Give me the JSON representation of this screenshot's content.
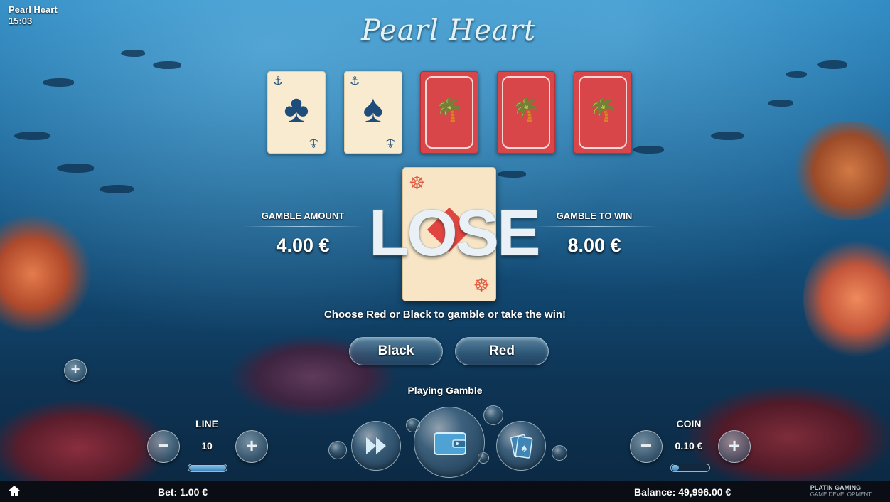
{
  "game": {
    "title": "Pearl Heart",
    "clock": "15:03",
    "logo_text": "Pearl Heart"
  },
  "history_cards": [
    {
      "state": "face",
      "suit": "clubs",
      "symbol": "♣",
      "color": "#1e4d7b"
    },
    {
      "state": "face",
      "suit": "spades",
      "symbol": "♠",
      "color": "#1e4d7b"
    },
    {
      "state": "back"
    },
    {
      "state": "back"
    },
    {
      "state": "back"
    }
  ],
  "current_card": {
    "suit": "diamonds",
    "color": "#e2453f"
  },
  "result_text": "LOSE",
  "gamble": {
    "amount_label": "GAMBLE AMOUNT",
    "amount_value": "4.00 €",
    "to_win_label": "GAMBLE TO WIN",
    "to_win_value": "8.00 €"
  },
  "prompt": "Choose Red or Black to gamble or take the win!",
  "buttons": {
    "black": "Black",
    "red": "Red"
  },
  "status": "Playing Gamble",
  "line": {
    "label": "LINE",
    "value": "10",
    "fill": 1.0
  },
  "coin": {
    "label": "COIN",
    "value": "0.10 €",
    "fill": 0.2
  },
  "bottom": {
    "bet": "Bet: 1.00 €",
    "balance": "Balance: 49,996.00 €",
    "brand_line1": "PLATIN GAMING",
    "brand_line2": "GAME DEVELOPMENT"
  },
  "icons": {
    "home": "home-icon",
    "fast_forward": "fast-forward-icon",
    "wallet": "wallet-icon",
    "cards": "cards-icon",
    "plus": "plus-icon",
    "minus": "minus-icon"
  }
}
